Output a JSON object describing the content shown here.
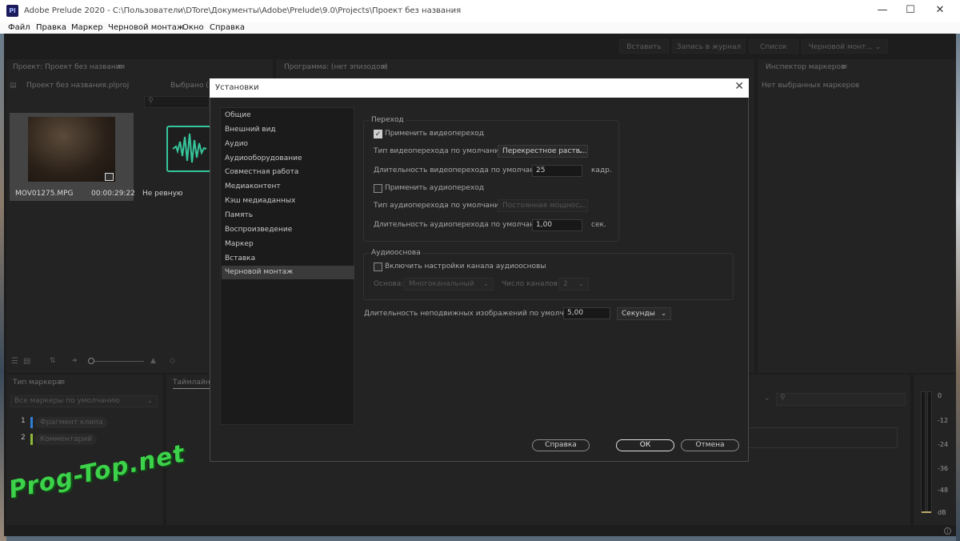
{
  "window": {
    "app_icon": "Pl",
    "title": "Adobe Prelude 2020 - C:\\Пользователи\\DTore\\Документы\\Adobe\\Prelude\\9.0\\Projects\\Проект без названия"
  },
  "menu": [
    "Файл",
    "Правка",
    "Маркер",
    "Черновой монтаж",
    "Окно",
    "Справка"
  ],
  "toolbar": {
    "insert": "Вставить",
    "log": "Запись в журнал",
    "list": "Список",
    "rough_cut": "Черновой монт..."
  },
  "project_panel": {
    "title": "Проект: Проект без названия",
    "file": "Проект без названия.plproj",
    "selected": "Выбрано (з",
    "clip_name": "MOV01275.MPG",
    "clip_duration": "00:00:29:22",
    "audio_label": "Не ревную"
  },
  "program_panel": {
    "title": "Программа: (нет эпизодов)"
  },
  "inspector_panel": {
    "title": "Инспектор маркеров",
    "empty": "Нет выбранных маркеров"
  },
  "marker_type_panel": {
    "title": "Тип маркера",
    "filter": "Все маркеры по умолчанию",
    "items": [
      {
        "num": "1",
        "label": "Фрагмент клипа",
        "color": "#2f7fd6"
      },
      {
        "num": "2",
        "label": "Комментарий",
        "color": "#8bb83a"
      }
    ]
  },
  "timeline_panel": {
    "title": "Таймлайн"
  },
  "meter": {
    "labels": [
      "0",
      "-12",
      "-24",
      "-36",
      "-48",
      "dB"
    ]
  },
  "dialog": {
    "title": "Установки",
    "categories": [
      "Общие",
      "Внешний вид",
      "Аудио",
      "Аудиооборудование",
      "Совместная работа",
      "Медиаконтент",
      "Кэш медиаданных",
      "Память",
      "Воспроизведение",
      "Маркер",
      "Вставка",
      "Черновой монтаж"
    ],
    "selected_category": "Черновой монтаж",
    "transition": {
      "group_title": "Переход",
      "apply_video": "Применить видеопереход",
      "apply_video_checked": true,
      "video_type_label": "Тип видеоперехода по умолчанию:",
      "video_type_value": "Перекрестное раств...",
      "video_duration_label": "Длительность видеоперехода по умолчанию:",
      "video_duration_value": "25",
      "video_duration_unit": "кадр.",
      "apply_audio": "Применить аудиопереход",
      "apply_audio_checked": false,
      "audio_type_label": "Тип аудиоперехода по умолчанию:",
      "audio_type_value": "Постоянная мощнос...",
      "audio_duration_label": "Длительность аудиоперехода по умолчанию:",
      "audio_duration_value": "1,00",
      "audio_duration_unit": "сек."
    },
    "audio_base": {
      "group_title": "Аудиооснова",
      "enable": "Включить настройки канала аудиоосновы",
      "enable_checked": false,
      "base_label": "Основа:",
      "base_value": "Многоканальный",
      "channels_label": "Число каналов:",
      "channels_value": "2"
    },
    "still_duration_label": "Длительность неподвижных изображений по умолчанию:",
    "still_duration_value": "5,00",
    "still_duration_unit": "Секунды",
    "buttons": {
      "help": "Справка",
      "ok": "ОК",
      "cancel": "Отмена"
    }
  },
  "watermark": "Prog-Top.net"
}
